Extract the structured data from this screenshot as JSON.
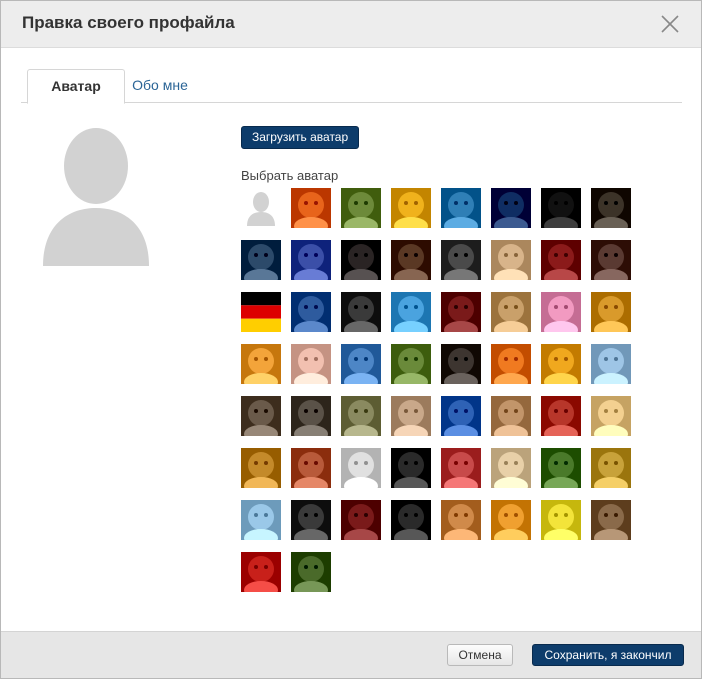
{
  "dialog": {
    "title": "Правка своего профайла",
    "close_icon": "close-icon"
  },
  "tabs": [
    {
      "label": "Аватар",
      "active": true
    },
    {
      "label": "Обо мне",
      "active": false
    }
  ],
  "avatar_panel": {
    "upload_label": "Загрузить аватар",
    "choose_label": "Выбрать аватар",
    "options": [
      {
        "name": "default-silhouette",
        "color": "#cfcfcf"
      },
      {
        "name": "star-face",
        "color": "#e8641b"
      },
      {
        "name": "dog",
        "color": "#6d8a3a"
      },
      {
        "name": "flower",
        "color": "#f0b21c"
      },
      {
        "name": "goldfish",
        "color": "#2f7fb6"
      },
      {
        "name": "earth",
        "color": "#0f2d63"
      },
      {
        "name": "handprint",
        "color": "#111111"
      },
      {
        "name": "ape",
        "color": "#3c3328"
      },
      {
        "name": "poster-sunset",
        "color": "#2c4a6a"
      },
      {
        "name": "wrestler",
        "color": "#3b4fa8"
      },
      {
        "name": "dark-portrait",
        "color": "#2a2424"
      },
      {
        "name": "cowboy",
        "color": "#5a3824"
      },
      {
        "name": "mustache-man",
        "color": "#4a4a4a"
      },
      {
        "name": "blonde-pop",
        "color": "#d8b48a"
      },
      {
        "name": "microphone-stage",
        "color": "#8b1a1a"
      },
      {
        "name": "game-woman",
        "color": "#5a3a32"
      },
      {
        "name": "german-flag",
        "color": "#dd0000"
      },
      {
        "name": "football-player",
        "color": "#2e5b9e"
      },
      {
        "name": "snake-soldier",
        "color": "#3a3a3a"
      },
      {
        "name": "smurf",
        "color": "#4aa3df"
      },
      {
        "name": "red-helmet",
        "color": "#7a1a1a"
      },
      {
        "name": "eye-closeup",
        "color": "#c9a06a"
      },
      {
        "name": "kirby",
        "color": "#f29ac1"
      },
      {
        "name": "winnie-pooh",
        "color": "#d99a2b"
      },
      {
        "name": "goku",
        "color": "#f3a43a"
      },
      {
        "name": "baby",
        "color": "#f2c0b0"
      },
      {
        "name": "thomas-train",
        "color": "#4d86c6"
      },
      {
        "name": "link-elf",
        "color": "#6a8a3a"
      },
      {
        "name": "bearded-man",
        "color": "#3d3530"
      },
      {
        "name": "lorax",
        "color": "#f07a20"
      },
      {
        "name": "beer-mug",
        "color": "#f0a81e"
      },
      {
        "name": "penguin",
        "color": "#9ec5e6"
      },
      {
        "name": "old-man",
        "color": "#6a5a4a"
      },
      {
        "name": "assassin",
        "color": "#5a5248"
      },
      {
        "name": "robot-frog",
        "color": "#8a8a60"
      },
      {
        "name": "screaming-woman",
        "color": "#c9a88a"
      },
      {
        "name": "bird-cartoon",
        "color": "#2e62b6"
      },
      {
        "name": "boy-smiling",
        "color": "#c2956a"
      },
      {
        "name": "superhero-figure",
        "color": "#b8362a"
      },
      {
        "name": "south-park-kid",
        "color": "#f3d090"
      },
      {
        "name": "puss-in-boots",
        "color": "#c48a2a"
      },
      {
        "name": "smiling-man",
        "color": "#b85a3a"
      },
      {
        "name": "bomberman",
        "color": "#e0e0e0"
      },
      {
        "name": "noir-gunman",
        "color": "#2a2a2a"
      },
      {
        "name": "anime-redhead",
        "color": "#c84a4a"
      },
      {
        "name": "blonde-girl",
        "color": "#e8d0a8"
      },
      {
        "name": "cucumbers",
        "color": "#4a7a2a"
      },
      {
        "name": "heisenberg",
        "color": "#c8a23a"
      },
      {
        "name": "paper-craft",
        "color": "#9ac8e8"
      },
      {
        "name": "anime-girl-dark",
        "color": "#3a3a3a"
      },
      {
        "name": "spaceship",
        "color": "#7a1a1a"
      },
      {
        "name": "asian-man",
        "color": "#2a2a2a"
      },
      {
        "name": "cat",
        "color": "#d08a4a"
      },
      {
        "name": "tiger-cartoon",
        "color": "#f0a030"
      },
      {
        "name": "spongebob",
        "color": "#f3e43a"
      },
      {
        "name": "sackboy",
        "color": "#8a6a4a"
      },
      {
        "name": "mario",
        "color": "#c8201a"
      },
      {
        "name": "link-cartoon",
        "color": "#4a6a2a"
      }
    ]
  },
  "footer": {
    "cancel_label": "Отмена",
    "save_label": "Сохранить, я закончил"
  }
}
